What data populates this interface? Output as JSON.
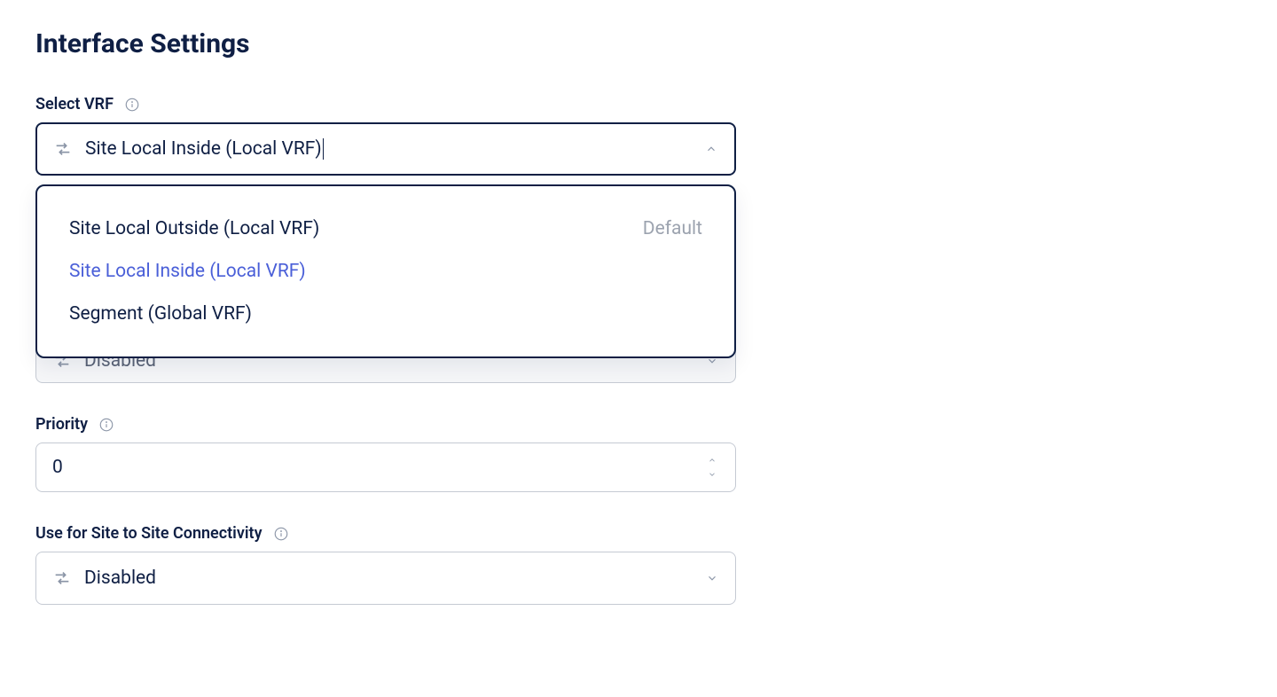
{
  "page_title": "Interface Settings",
  "vrf": {
    "label": "Select VRF",
    "value": "Site Local Inside (Local VRF)",
    "options": [
      {
        "label": "Site Local Outside (Local VRF)",
        "badge": "Default"
      },
      {
        "label": "Site Local Inside (Local VRF)",
        "badge": ""
      },
      {
        "label": "Segment (Global VRF)",
        "badge": ""
      }
    ]
  },
  "hidden_field": {
    "value": "Disabled"
  },
  "priority": {
    "label": "Priority",
    "value": "0"
  },
  "site_to_site": {
    "label": "Use for Site to Site Connectivity",
    "value": "Disabled"
  }
}
